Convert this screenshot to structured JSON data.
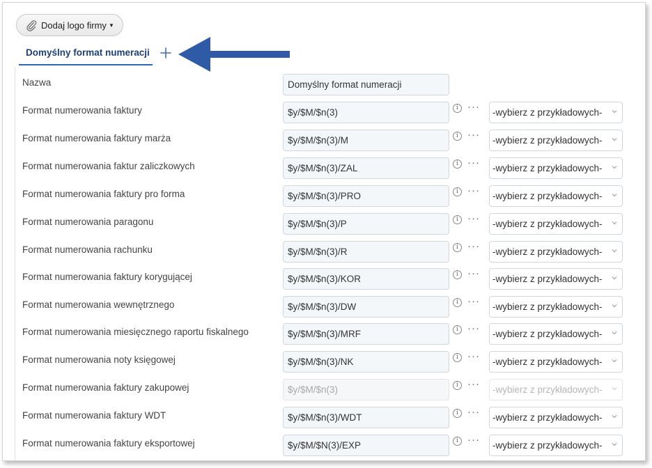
{
  "toolbar": {
    "logo_button_label": "Dodaj logo firmy"
  },
  "tabs": {
    "active_label": "Domyślny format numeracji"
  },
  "rows": [
    {
      "label": "Nazwa",
      "value": "Domyślny format numeracji"
    },
    {
      "label": "Format numerowania faktury",
      "value": "$y/$M/$n(3)",
      "select": "-wybierz z przykładowych-"
    },
    {
      "label": "Format numerowania faktury marża",
      "value": "$y/$M/$n(3)/M",
      "select": "-wybierz z przykładowych-"
    },
    {
      "label": "Format numerowania faktur zaliczkowych",
      "value": "$y/$M/$n(3)/ZAL",
      "select": "-wybierz z przykładowych-"
    },
    {
      "label": "Format numerowania faktury pro forma",
      "value": "$y/$M/$n(3)/PRO",
      "select": "-wybierz z przykładowych-"
    },
    {
      "label": "Format numerowania paragonu",
      "value": "$y/$M/$n(3)/P",
      "select": "-wybierz z przykładowych-"
    },
    {
      "label": "Format numerowania rachunku",
      "value": "$y/$M/$n(3)/R",
      "select": "-wybierz z przykładowych-"
    },
    {
      "label": "Format numerowania faktury korygującej",
      "value": "$y/$M/$n(3)/KOR",
      "select": "-wybierz z przykładowych-"
    },
    {
      "label": "Format numerowania wewnętrznego",
      "value": "$y/$M/$n(3)/DW",
      "select": "-wybierz z przykładowych-"
    },
    {
      "label": "Format numerowania miesięcznego raportu fiskalnego",
      "value": "$y/$M/$n(3)/MRF",
      "select": "-wybierz z przykładowych-"
    },
    {
      "label": "Format numerowania noty księgowej",
      "value": "$y/$M/$n(3)/NK",
      "select": "-wybierz z przykładowych-"
    },
    {
      "label": "Format numerowania faktury zakupowej",
      "value": "$y/$M/$n(3)",
      "select": "-wybierz z przykładowych-"
    },
    {
      "label": "Format numerowania faktury WDT",
      "value": "$y/$M/$n(3)/WDT",
      "select": "-wybierz z przykładowych-"
    },
    {
      "label": "Format numerowania faktury eksportowej",
      "value": "$y/$M/$N(3)/EXP",
      "select": "-wybierz z przykładowych-"
    }
  ],
  "icons": {
    "logo_button": "paperclip-icon",
    "add_tab": "plus-icon",
    "info": "info-icon",
    "more": "more-dots-icon",
    "select": "chevron-down-icon",
    "annotation": "arrow-left-icon"
  },
  "colors": {
    "tab_active": "#1f3f77",
    "tab_underline": "#2b6ab0",
    "arrow": "#2f5aa5"
  }
}
